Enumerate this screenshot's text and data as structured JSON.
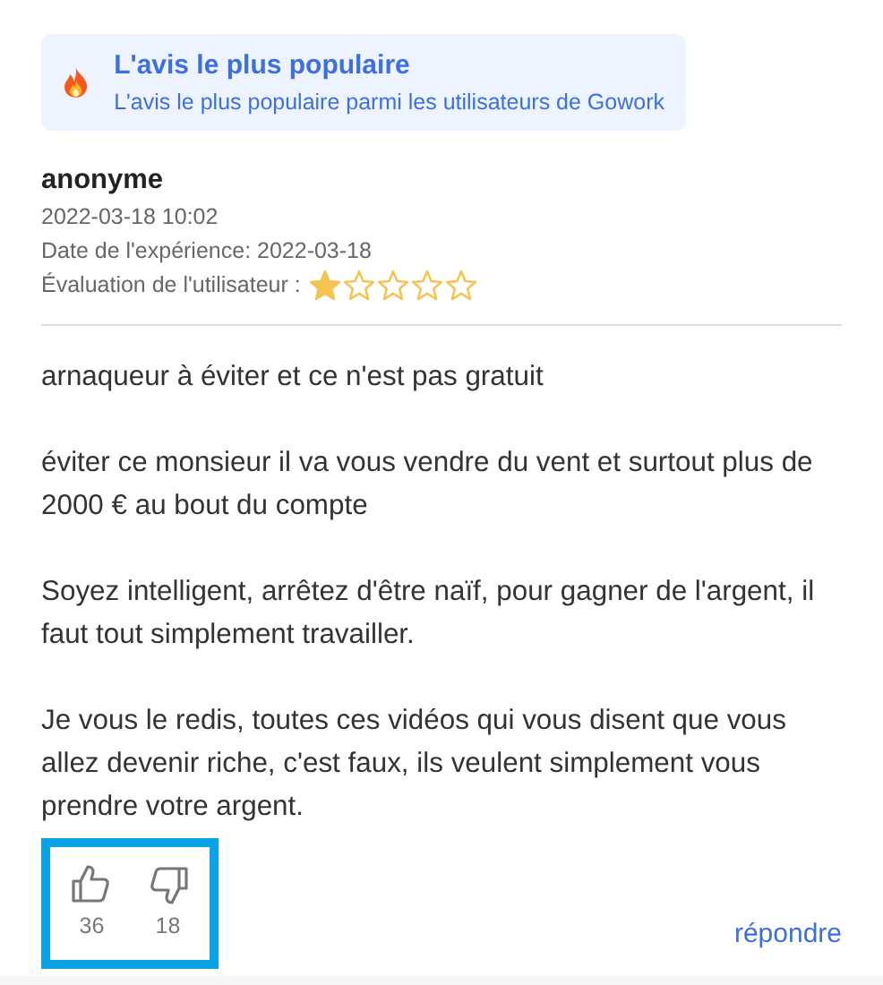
{
  "banner": {
    "title": "L'avis le plus populaire",
    "subtitle": "L'avis le plus populaire parmi les utilisateurs de Gowork"
  },
  "review": {
    "author": "anonyme",
    "posted": "2022-03-18 10:02",
    "experience_date": "Date de l'expérience: 2022-03-18",
    "rating_label": "Évaluation de l'utilisateur :",
    "stars": 1,
    "paragraphs": [
      "arnaqueur à éviter et ce n'est pas gratuit",
      "éviter ce monsieur il va vous vendre du vent et surtout plus de 2000 € au bout du compte",
      "Soyez intelligent, arrêtez d'être naïf, pour gagner de l'argent, il faut tout simplement travailler.",
      "Je vous le redis, toutes ces vidéos qui vous disent que vous allez devenir riche, c'est faux, ils veulent simplement vous prendre votre argent."
    ]
  },
  "votes": {
    "likes": "36",
    "dislikes": "18"
  },
  "reply_link": "répondre"
}
